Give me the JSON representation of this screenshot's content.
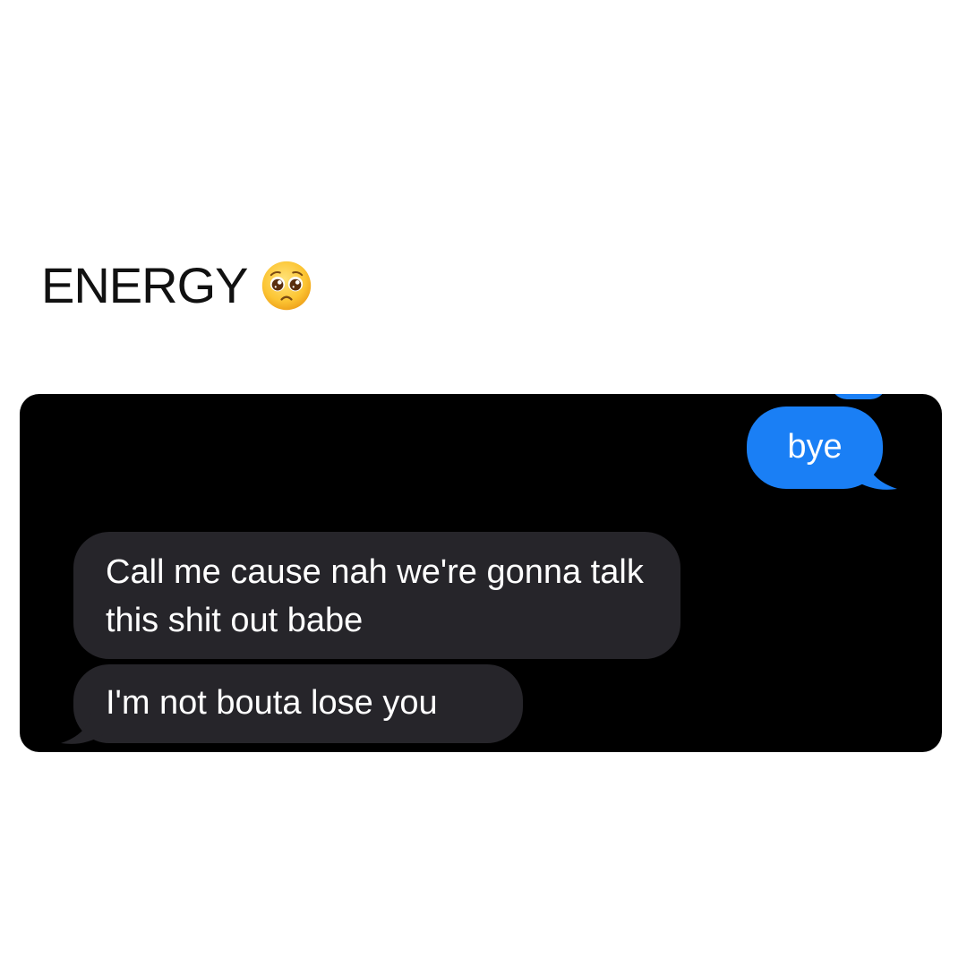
{
  "caption": {
    "text": "ENERGY",
    "emoji_icon": "pleading-face-emoji"
  },
  "messages": [
    {
      "side": "sent",
      "text": "bye",
      "color": "#1a7ff5"
    },
    {
      "side": "received",
      "text": "Call me cause nah we're gonna talk this shit out babe",
      "color": "#26252a"
    },
    {
      "side": "received",
      "text": "I'm not bouta lose you",
      "color": "#26252a"
    }
  ],
  "theme": {
    "chat_background": "#000000",
    "sent_bubble": "#1a7ff5",
    "received_bubble": "#26252a",
    "text_on_bubble": "#ffffff"
  }
}
